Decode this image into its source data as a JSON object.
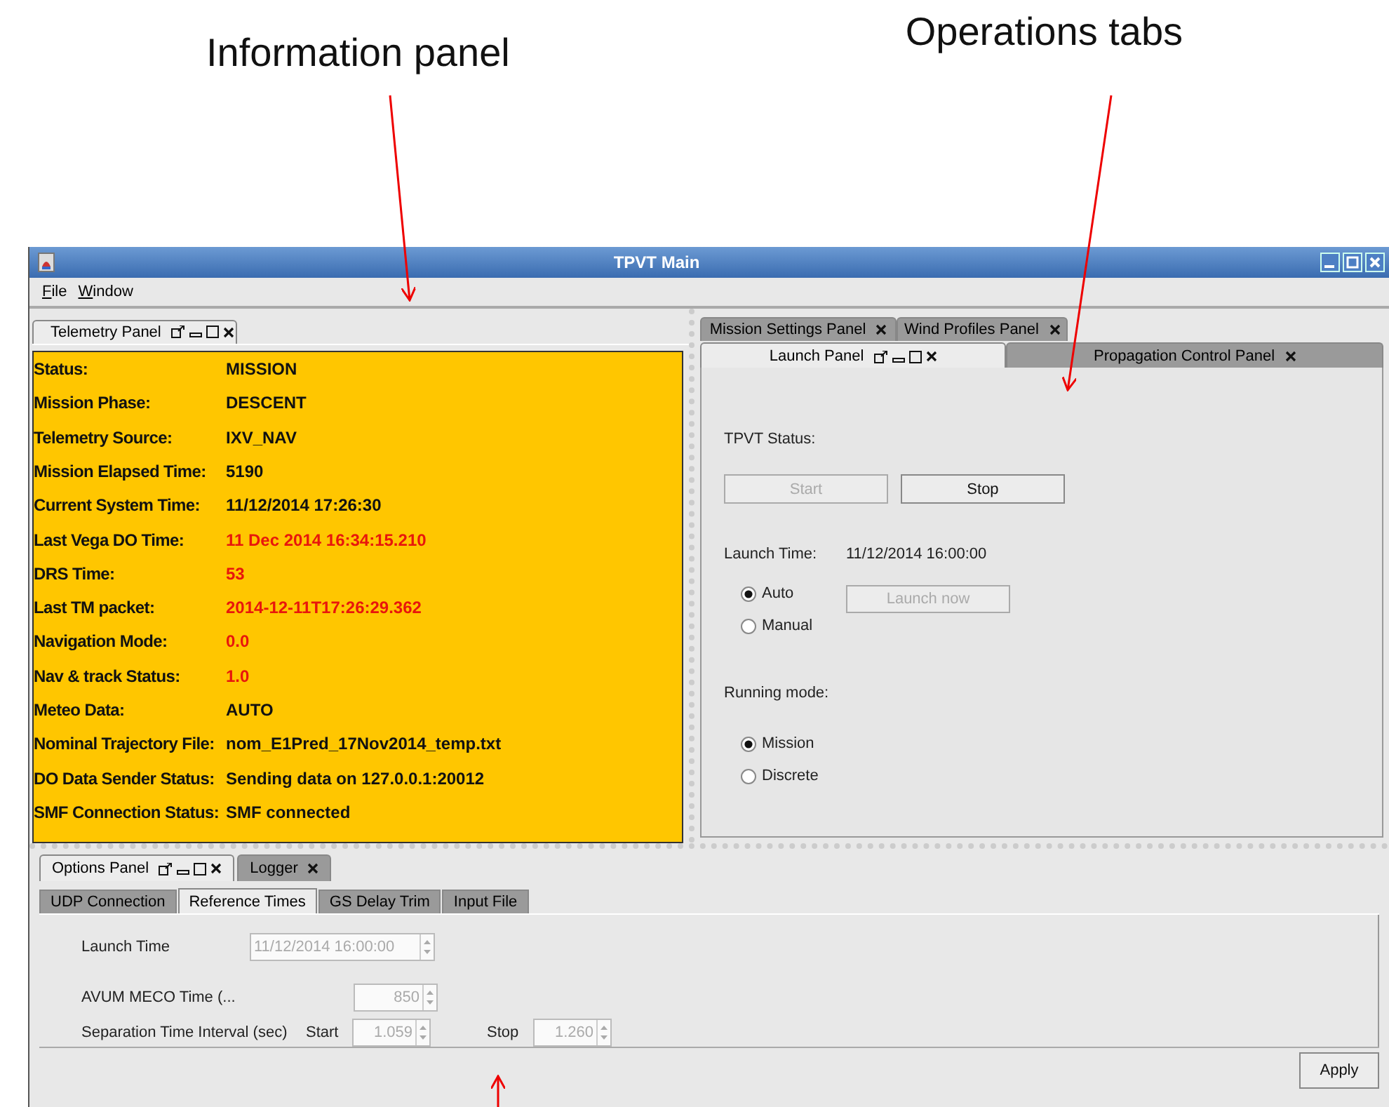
{
  "annotations": [
    {
      "text": "Information panel"
    },
    {
      "text": "Operations tabs"
    }
  ],
  "window": {
    "title": "TPVT Main"
  },
  "menu": [
    {
      "label": "File"
    },
    {
      "label": "Window"
    }
  ],
  "telemetry_panel": {
    "tab": {
      "label": "Telemetry Panel",
      "selected": true
    },
    "rows": [
      {
        "label": "Status:",
        "value": "MISSION",
        "alert": false
      },
      {
        "label": "Mission Phase:",
        "value": "DESCENT",
        "alert": false
      },
      {
        "label": "Telemetry Source:",
        "value": "IXV_NAV",
        "alert": false
      },
      {
        "label": "Mission Elapsed Time:",
        "value": "5190",
        "alert": false
      },
      {
        "label": "Current System Time:",
        "value": "11/12/2014 17:26:30",
        "alert": false
      },
      {
        "label": "Last Vega DO Time:",
        "value": "11 Dec 2014 16:34:15.210",
        "alert": true
      },
      {
        "label": "DRS Time:",
        "value": "53",
        "alert": true
      },
      {
        "label": "Last TM packet:",
        "value": "2014-12-11T17:26:29.362",
        "alert": true
      },
      {
        "label": "Navigation Mode:",
        "value": "0.0",
        "alert": true
      },
      {
        "label": "Nav & track Status:",
        "value": "1.0",
        "alert": true
      },
      {
        "label": "Meteo Data:",
        "value": "AUTO",
        "alert": false
      },
      {
        "label": "Nominal Trajectory File:",
        "value": "nom_E1Pred_17Nov2014_temp.txt",
        "alert": false
      },
      {
        "label": "DO Data Sender Status:",
        "value": "Sending data on 127.0.0.1:20012",
        "alert": false
      },
      {
        "label": "SMF Connection Status:",
        "value": "SMF connected",
        "alert": false
      }
    ]
  },
  "operations": {
    "tab_rows": [
      [
        {
          "label": "Mission Settings Panel",
          "selected": false
        },
        {
          "label": "Wind Profiles Panel",
          "selected": false
        }
      ],
      [
        {
          "label": "Launch Panel",
          "selected": true
        },
        {
          "label": "Propagation Control Panel",
          "selected": false
        }
      ]
    ],
    "launch_panel": {
      "status_label": "TPVT Status:",
      "buttons": [
        {
          "label": "Start",
          "disabled": true
        },
        {
          "label": "Stop",
          "disabled": false
        }
      ],
      "launch_time_label": "Launch Time:",
      "launch_time_value": "11/12/2014 16:00:00",
      "launch_modes": [
        {
          "label": "Auto",
          "selected": true
        },
        {
          "label": "Manual",
          "selected": false
        }
      ],
      "launch_now": {
        "label": "Launch now",
        "disabled": true
      },
      "running_mode_label": "Running mode:",
      "running_modes": [
        {
          "label": "Mission",
          "selected": true
        },
        {
          "label": "Discrete",
          "selected": false
        }
      ]
    }
  },
  "options": {
    "tabs": [
      {
        "label": "Options Panel",
        "selected": true
      },
      {
        "label": "Logger",
        "selected": false
      }
    ],
    "subtabs": [
      {
        "label": "UDP Connection",
        "selected": false
      },
      {
        "label": "Reference Times",
        "selected": true
      },
      {
        "label": "GS Delay Trim",
        "selected": false
      },
      {
        "label": "Input File",
        "selected": false
      }
    ],
    "fields": [
      {
        "kind": "wide",
        "label": "Launch Time",
        "value": "11/12/2014 16:00:00",
        "disabled": true
      },
      {
        "kind": "narrow",
        "label": "AVUM MECO Time (...",
        "value": "850",
        "disabled": true
      }
    ],
    "separation": {
      "label": "Separation Time Interval (sec)",
      "start_label": "Start",
      "start_value": "1.059",
      "stop_label": "Stop",
      "stop_value": "1.260",
      "disabled": true
    },
    "apply": {
      "label": "Apply"
    }
  }
}
